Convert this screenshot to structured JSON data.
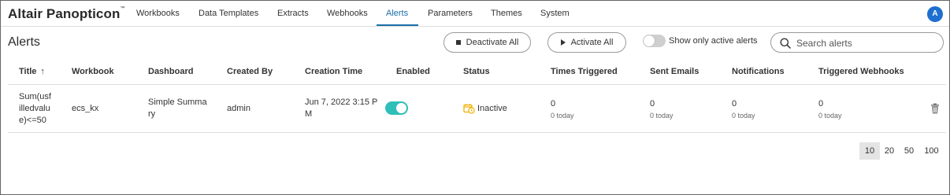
{
  "app": {
    "brand": "Altair Panopticon",
    "trademark": "™"
  },
  "nav": {
    "items": [
      "Workbooks",
      "Data Templates",
      "Extracts",
      "Webhooks",
      "Alerts",
      "Parameters",
      "Themes",
      "System"
    ],
    "active": "Alerts"
  },
  "user": {
    "avatar_initial": "A"
  },
  "page": {
    "title": "Alerts",
    "deactivate_all": "Deactivate All",
    "activate_all": "Activate All",
    "show_active_label": "Show only active alerts",
    "show_active_on": false,
    "search_placeholder": "Search alerts"
  },
  "table": {
    "columns": [
      "Title",
      "Workbook",
      "Dashboard",
      "Created By",
      "Creation Time",
      "Enabled",
      "Status",
      "Times Triggered",
      "Sent Emails",
      "Notifications",
      "Triggered Webhooks"
    ],
    "sort": {
      "column": "Title",
      "direction": "ascending",
      "arrow": "↑"
    },
    "rows": [
      {
        "title_lines": [
          "Sum(usf",
          "illedvalu",
          "e)<=50"
        ],
        "workbook": "ecs_kx",
        "dashboard_lines": [
          "Simple Summa",
          "ry"
        ],
        "created_by": "admin",
        "creation_time_lines": [
          "Jun 7, 2022 3:15 P",
          "M"
        ],
        "enabled": true,
        "status": "Inactive",
        "times_triggered": "0",
        "times_triggered_today": "0 today",
        "sent_emails": "0",
        "sent_emails_today": "0 today",
        "notifications": "0",
        "notifications_today": "0 today",
        "triggered_webhooks": "0",
        "triggered_webhooks_today": "0 today"
      }
    ]
  },
  "pagination": {
    "sizes": [
      "10",
      "20",
      "50",
      "100"
    ],
    "selected": "10"
  },
  "colors": {
    "accent": "#1a6fa8",
    "toggle_on": "#2fbfb8",
    "avatar": "#1e6fd0",
    "status_icon": "#f0b000"
  }
}
